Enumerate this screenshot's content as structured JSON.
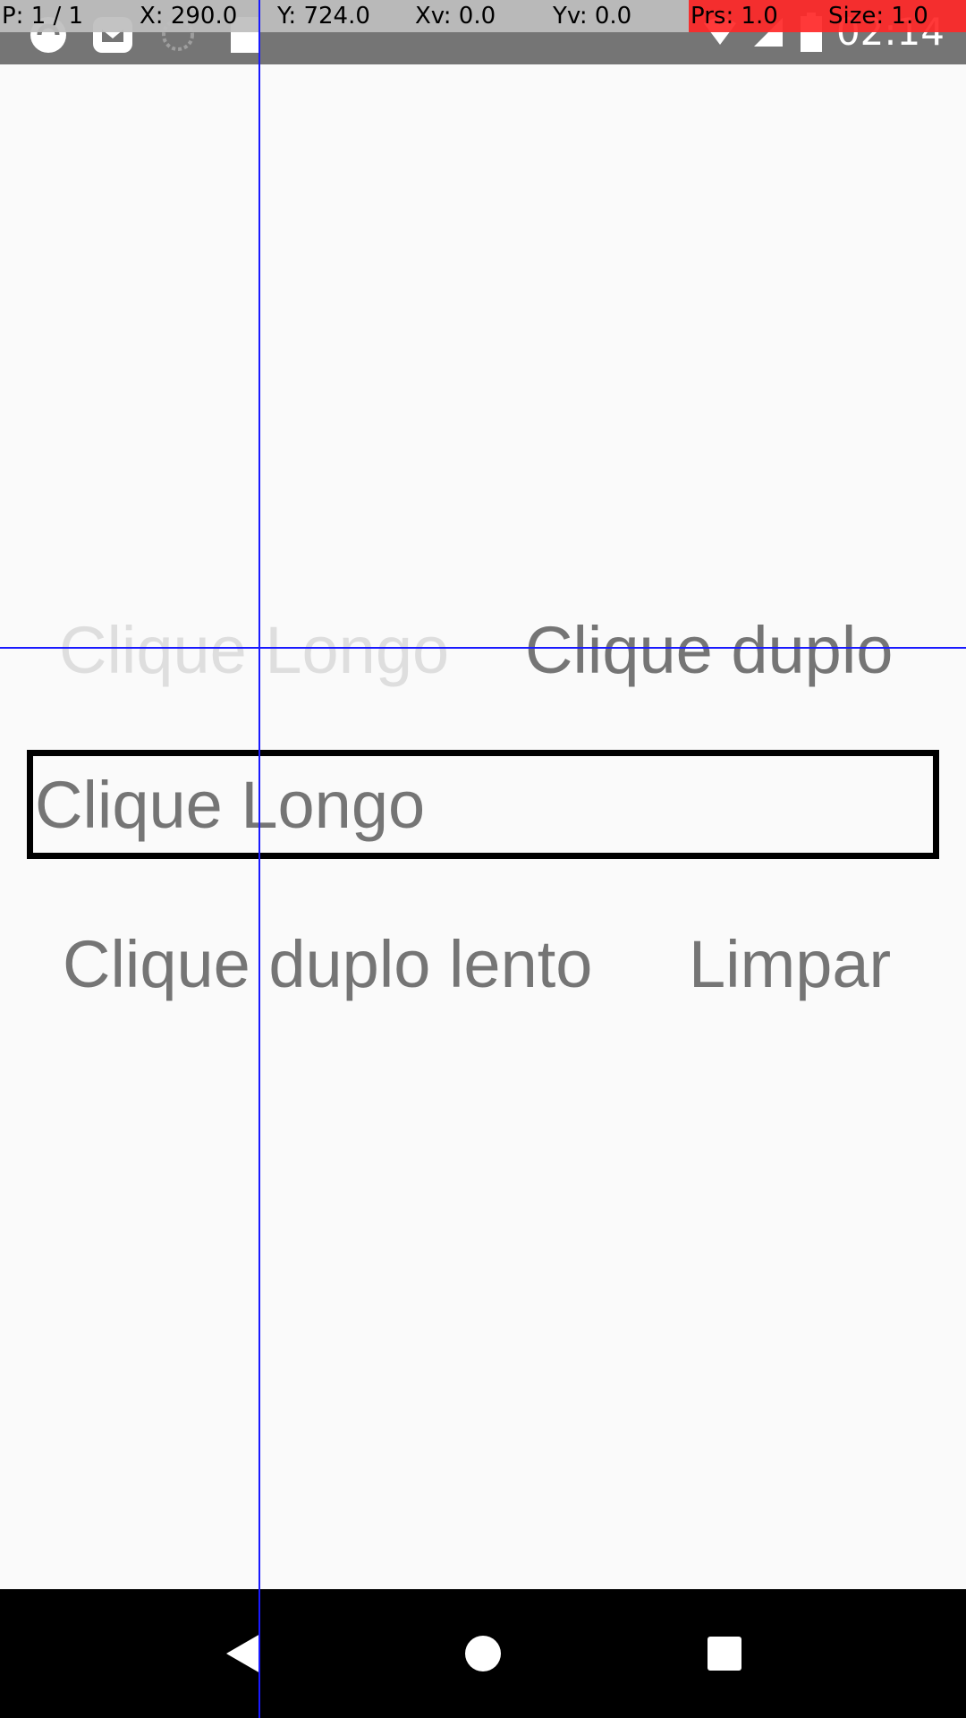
{
  "status_bar": {
    "clock": "02:14",
    "icons": [
      "app-icon",
      "mail-icon",
      "sync-icon",
      "sd-card-icon",
      "wifi-icon",
      "signal-icon",
      "battery-icon"
    ]
  },
  "pointer_overlay": {
    "pointers": "P: 1 / 1",
    "x": "X: 290.0",
    "y": "Y: 724.0",
    "xv": "Xv: 0.0",
    "yv": "Yv: 0.0",
    "prs": "Prs: 1.0",
    "size": "Size: 1.0"
  },
  "buttons": {
    "long_click": "Clique Longo",
    "double_click": "Clique duplo",
    "slow_double_click": "Clique duplo lento",
    "clear": "Limpar"
  },
  "result": {
    "text": "Clique Longo"
  },
  "colors": {
    "background": "#fafafa",
    "text": "#757575",
    "text_pressed": "#dedede",
    "crosshair": "#1a1aff",
    "overlay_red": "#ff2828"
  }
}
